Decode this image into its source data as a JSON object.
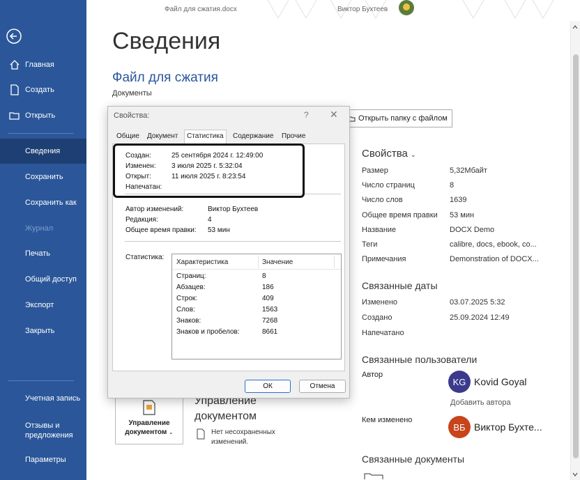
{
  "window": {
    "document_title": "Файл для сжатия.docx",
    "user_name": "Виктор Бухтеев"
  },
  "sidebar": {
    "items": [
      {
        "label": "Главная",
        "icon": "home-icon"
      },
      {
        "label": "Создать",
        "icon": "new-document-icon"
      },
      {
        "label": "Открыть",
        "icon": "open-folder-icon"
      },
      {
        "label": "Сведения"
      },
      {
        "label": "Сохранить"
      },
      {
        "label": "Сохранить как"
      },
      {
        "label": "Журнал"
      },
      {
        "label": "Печать"
      },
      {
        "label": "Общий доступ"
      },
      {
        "label": "Экспорт"
      },
      {
        "label": "Закрыть"
      },
      {
        "label": "Учетная запись"
      },
      {
        "label": "Отзывы и предложения"
      },
      {
        "label": "Параметры"
      }
    ],
    "active_index": 3,
    "color": "#2b579a"
  },
  "main": {
    "heading": "Сведения",
    "file_title": "Файл для сжатия",
    "file_path": "Документы",
    "open_folder_button": "Открыть папку с файлом",
    "properties_header": "Свойства",
    "properties": [
      {
        "key": "Размер",
        "value": "5,32Мбайт"
      },
      {
        "key": "Число страниц",
        "value": "8"
      },
      {
        "key": "Число слов",
        "value": "1639"
      },
      {
        "key": "Общее время правки",
        "value": "53 мин"
      },
      {
        "key": "Название",
        "value": "DOCX Demo"
      },
      {
        "key": "Теги",
        "value": "calibre, docs, ebook, co..."
      },
      {
        "key": "Примечания",
        "value": "Demonstration of DOCX..."
      }
    ],
    "related_dates_header": "Связанные даты",
    "related_dates": [
      {
        "key": "Изменено",
        "value": "03.07.2025 5:32"
      },
      {
        "key": "Создано",
        "value": "25.09.2024 12:49"
      },
      {
        "key": "Напечатано",
        "value": ""
      }
    ],
    "related_people_header": "Связанные пользователи",
    "author_label": "Автор",
    "author": {
      "initials": "KG",
      "name": "Kovid Goyal",
      "color": "#3b3a8c"
    },
    "add_author": "Добавить автора",
    "modified_by_label": "Кем изменено",
    "modified_by": {
      "initials": "ВБ",
      "name": "Виктор Бухте...",
      "color": "#c8441b"
    },
    "related_docs_header": "Связанные документы",
    "manage": {
      "button_label": "Управление документом",
      "title": "Управление документом",
      "note": "Нет несохраненных изменений."
    }
  },
  "dialog": {
    "title": "Свойства:",
    "help": "?",
    "close": "✕",
    "tabs": [
      "Общие",
      "Документ",
      "Статистика",
      "Содержание",
      "Прочие"
    ],
    "active_tab": 2,
    "dates": [
      {
        "key": "Создан:",
        "value": "25 сентября 2024 г. 12:49:00"
      },
      {
        "key": "Изменен:",
        "value": "3 июля 2025 г. 5:32:04"
      },
      {
        "key": "Открыт:",
        "value": "11 июля 2025 г. 8:23:54"
      },
      {
        "key": "Напечатан:",
        "value": ""
      }
    ],
    "meta": [
      {
        "key": "Автор изменений:",
        "value": "Виктор Бухтеев"
      },
      {
        "key": "Редакция:",
        "value": "4"
      },
      {
        "key": "Общее время правки:",
        "value": "53 мин"
      }
    ],
    "stats_label": "Статистика:",
    "stats_columns": [
      "Характеристика",
      "Значение"
    ],
    "stats_rows": [
      {
        "key": "Страниц:",
        "value": "8"
      },
      {
        "key": "Абзацев:",
        "value": "186"
      },
      {
        "key": "Строк:",
        "value": "409"
      },
      {
        "key": "Слов:",
        "value": "1563"
      },
      {
        "key": "Знаков:",
        "value": "7268"
      },
      {
        "key": "Знаков и пробелов:",
        "value": "8661"
      }
    ],
    "ok": "ОК",
    "cancel": "Отмена"
  }
}
